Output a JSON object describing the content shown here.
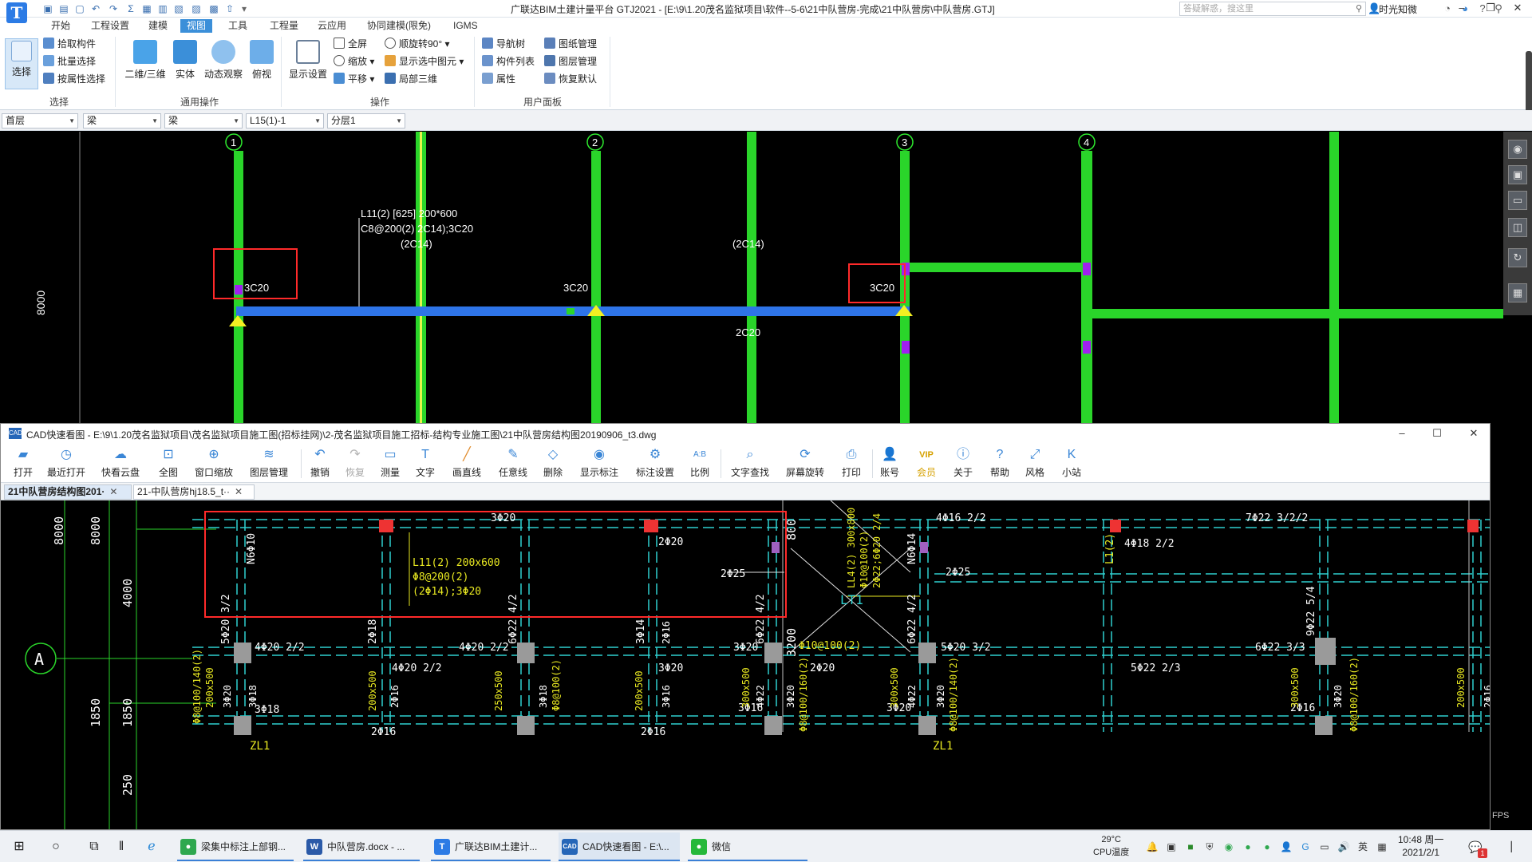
{
  "gtj": {
    "title": "广联达BIM土建计量平台 GTJ2021 - [E:\\9\\1.20茂名监狱项目\\软件--5-6\\21中队营房-完成\\21中队营房\\中队营房.GTJ]",
    "search_placeholder": "答疑解惑，搜这里",
    "user": "时光知微",
    "menu": [
      "开始",
      "工程设置",
      "建模",
      "视图",
      "工具",
      "工程量",
      "云应用",
      "协同建模(限免)",
      "IGMS"
    ],
    "active_menu": "视图",
    "ribbon": {
      "select_group": {
        "label": "选择",
        "big": "选择",
        "items": [
          "拾取构件",
          "批量选择",
          "按属性选择"
        ]
      },
      "common_group": {
        "label": "通用操作",
        "items": [
          "二维/三维",
          "实体",
          "动态观察",
          "俯视"
        ]
      },
      "ops_group": {
        "label": "操作",
        "big": "显示设置",
        "col1": [
          "全屏",
          "缩放",
          "平移"
        ],
        "col2": [
          "顺旋转90°",
          "显示选中图元",
          "局部三维"
        ]
      },
      "panel_group": {
        "label": "用户面板",
        "col1": [
          "导航树",
          "构件列表",
          "属性"
        ],
        "col2": [
          "图纸管理",
          "图层管理",
          "恢复默认"
        ]
      }
    },
    "filters": [
      "首层",
      "梁",
      "梁",
      "L15(1)-1",
      "分层1"
    ],
    "axes": [
      "1",
      "2",
      "3",
      "4"
    ],
    "dim_left": "8000",
    "labels": {
      "beam_name": "L11(2) [625] 200*600",
      "beam_rebar": "C8@200(2) 2C14);3C20",
      "span1": "(2C14)",
      "span2": "(2C14)",
      "top1": "3C20",
      "top2": "3C20",
      "top3": "3C20",
      "bottom": "2C20"
    }
  },
  "cad": {
    "title": "CAD快速看图 - E:\\9\\1.20茂名监狱项目\\茂名监狱项目施工图(招标挂网)\\2-茂名监狱项目施工招标-结构专业施工图\\21中队营房结构图20190906_t3.dwg",
    "toolbar": [
      "打开",
      "最近打开",
      "快看云盘",
      "全图",
      "窗口缩放",
      "图层管理",
      "撤销",
      "恢复",
      "测量",
      "文字",
      "画直线",
      "任意线",
      "删除",
      "显示标注",
      "标注设置",
      "比例",
      "文字查找",
      "屏幕旋转",
      "打印",
      "账号",
      "会员",
      "关于",
      "帮助",
      "风格",
      "小站"
    ],
    "tabs": [
      "21中队营房结构图201·",
      "21-中队营房hj18.5_t··"
    ],
    "drawing": {
      "dims": [
        "8000",
        "8000",
        "4000",
        "1850",
        "1850",
        "250",
        "800",
        "3200"
      ],
      "axis_a": "A",
      "top_rebars": [
        "3Φ20",
        "4Φ16  2/2",
        "7Φ22  3/2/2",
        "4Φ18  2/2",
        "2Φ20"
      ],
      "beam_callout": [
        "L11(2)  200x600",
        "Φ8@200(2)",
        "(2Φ14);3Φ20"
      ],
      "diag_callout": [
        "LL4(2)  300x800",
        "Φ10@100(2)",
        "2Φ22;6Φ20  2/4"
      ],
      "lt": "LT1",
      "zl": [
        "ZL1",
        "ZL1"
      ],
      "misc": [
        "2Φ25",
        "2Φ25",
        "N6Φ10",
        "N6Φ14",
        "L1(2)",
        "5Φ20  3/2",
        "2Φ18",
        "6Φ22  4/2",
        "3Φ14",
        "6Φ22  4/2",
        "6Φ22  4/2",
        "9Φ22  5/4"
      ],
      "mid_rebars": [
        "4Φ20  2/2",
        "4Φ20  2/2",
        "3Φ20",
        "Φ10@100(2)",
        "5Φ20  3/2",
        "6Φ22  3/3",
        "4Φ20  2/2",
        "3Φ20",
        "2Φ20",
        "5Φ22  2/3"
      ],
      "low_rebars": [
        "3Φ18",
        "2Φ16",
        "2Φ16",
        "3Φ16",
        "3Φ20",
        "2Φ16"
      ],
      "vert_yellow": [
        "Φ8@100/140(2)",
        "200x500",
        "200x500",
        "250x500",
        "Φ8@100(2)",
        "200x500",
        "300x500",
        "Φ8@100/160(2)",
        "300x500",
        "Φ8@100/140(2)",
        "300x500",
        "Φ8@100/160(2)",
        "200x500"
      ],
      "vert_white": [
        "3Φ20",
        "3Φ18",
        "2Φ16",
        "3Φ18",
        "3Φ16",
        "2Φ16",
        "4Φ22",
        "3Φ20",
        "4Φ22",
        "3Φ20",
        "3Φ20",
        "2Φ16"
      ]
    }
  },
  "fps": "FPS",
  "taskbar": {
    "apps": [
      "梁集中标注上部钢...",
      "中队营房.docx - ...",
      "广联达BIM土建计...",
      "CAD快速看图 - E:\\...",
      "微信"
    ],
    "temp": "29°C",
    "cpu": "CPU温度",
    "lang": "英",
    "time": "10:48 周一",
    "date": "2021/2/1",
    "badge": "1"
  }
}
